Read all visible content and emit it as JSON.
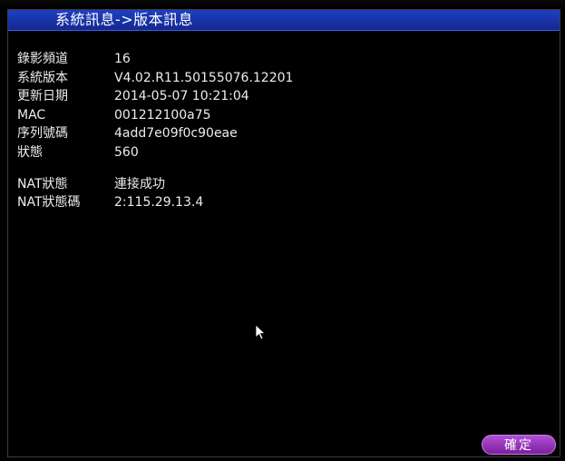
{
  "window": {
    "title": "系統訊息->版本訊息"
  },
  "info": {
    "rows": [
      {
        "label": "錄影頻道",
        "value": "16"
      },
      {
        "label": "系統版本",
        "value": "V4.02.R11.50155076.12201"
      },
      {
        "label": "更新日期",
        "value": "2014-05-07 10:21:04"
      },
      {
        "label": "MAC",
        "value": "001212100a75"
      },
      {
        "label": "序列號碼",
        "value": "4add7e09f0c90eae"
      },
      {
        "label": "狀態",
        "value": "560"
      }
    ],
    "nat_rows": [
      {
        "label": "NAT狀態",
        "value": "連接成功"
      },
      {
        "label": "NAT狀態碼",
        "value": "2:115.29.13.4"
      }
    ]
  },
  "buttons": {
    "ok_label": "確定"
  },
  "colors": {
    "titlebar": "#1f3fc2",
    "background": "#000000",
    "text": "#ececec",
    "ok_button": "#9b3cc4"
  },
  "icons": {
    "pointer": "mouse-pointer-icon"
  }
}
